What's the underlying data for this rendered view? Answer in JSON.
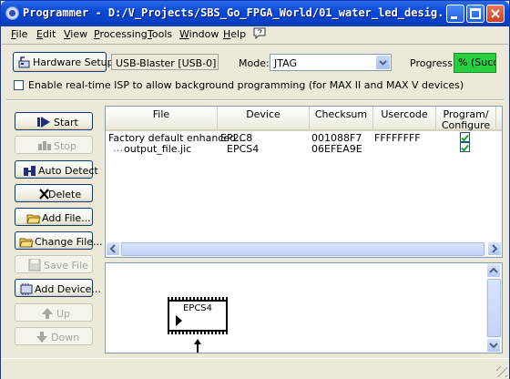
{
  "window": {
    "title": "Programmer - D:/V_Projects/SBS_Go_FPGA_World/01_water_led_desig..."
  },
  "menu": [
    {
      "key": "F",
      "rest": "ile"
    },
    {
      "key": "E",
      "rest": "dit"
    },
    {
      "key": "V",
      "rest": "iew"
    },
    {
      "key": "P",
      "rest": "rocessing"
    },
    {
      "key": "T",
      "rest": "ools"
    },
    {
      "key": "W",
      "rest": "indow"
    },
    {
      "key": "H",
      "rest": "elp"
    }
  ],
  "hardware": {
    "setup_button": "Hardware Setup...",
    "adapter": "USB-Blaster [USB-0]",
    "mode_label": "Mode:",
    "mode_value": "JTAG",
    "progress_label": "Progress:",
    "progress_text": "% (Succes",
    "isp_label": "Enable real-time ISP to allow background programming (for MAX II and MAX V devices)"
  },
  "side_buttons": {
    "start": "Start",
    "stop": "Stop",
    "auto_detect": "Auto Detect",
    "delete": "Delete",
    "add_file": "Add File...",
    "change_file": "Change File...",
    "save_file": "Save File",
    "add_device": "Add Device...",
    "up": "Up",
    "down": "Down"
  },
  "table": {
    "columns": [
      "File",
      "Device",
      "Checksum",
      "Usercode",
      "Program/ Configure"
    ],
    "col_program_line1": "Program/",
    "col_program_line2": "Configure",
    "rows": [
      {
        "file": "Factory default enhanced...",
        "device": "EP2C8",
        "checksum": "001088F7",
        "usercode": "FFFFFFFF",
        "program": true
      },
      {
        "file": "output_file.jic",
        "device": "EPCS4",
        "checksum": "06EFEA9E",
        "usercode": "",
        "program": true
      }
    ]
  },
  "diagram": {
    "chip_label": "EPCS4"
  },
  "colors": {
    "title_bar": "#0a4ad8",
    "progress_fill": "#28d040"
  }
}
